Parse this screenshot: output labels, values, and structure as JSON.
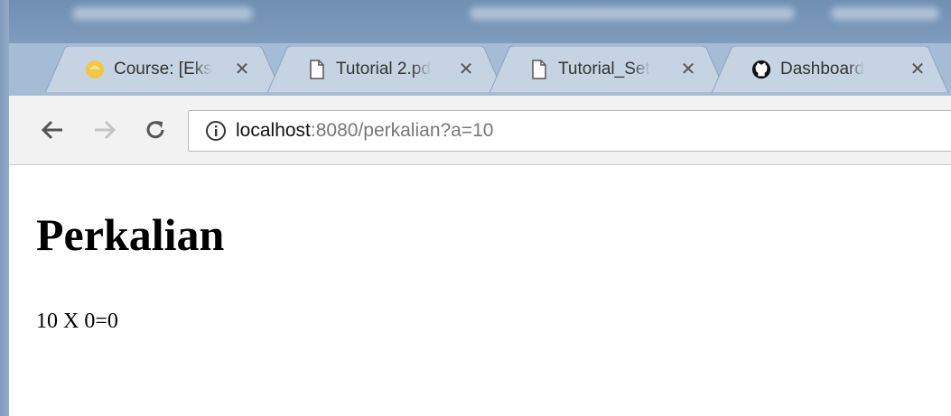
{
  "browser": {
    "tabs": [
      {
        "title": "Course: [Eks",
        "icon": "course-favicon-icon"
      },
      {
        "title": "Tutorial 2.pd",
        "icon": "document-icon"
      },
      {
        "title": "Tutorial_Set",
        "icon": "document-icon"
      },
      {
        "title": "Dashboard",
        "icon": "github-icon"
      }
    ],
    "close_glyph": "✕",
    "address": {
      "host": "localhost",
      "rest": ":8080/perkalian?a=10"
    }
  },
  "page": {
    "heading": "Perkalian",
    "result": "10 X 0=0"
  },
  "colors": {
    "tabstrip": "#a5bcd7",
    "toolbar": "#f2f2f2",
    "window_frame": "#7f9bbd"
  }
}
